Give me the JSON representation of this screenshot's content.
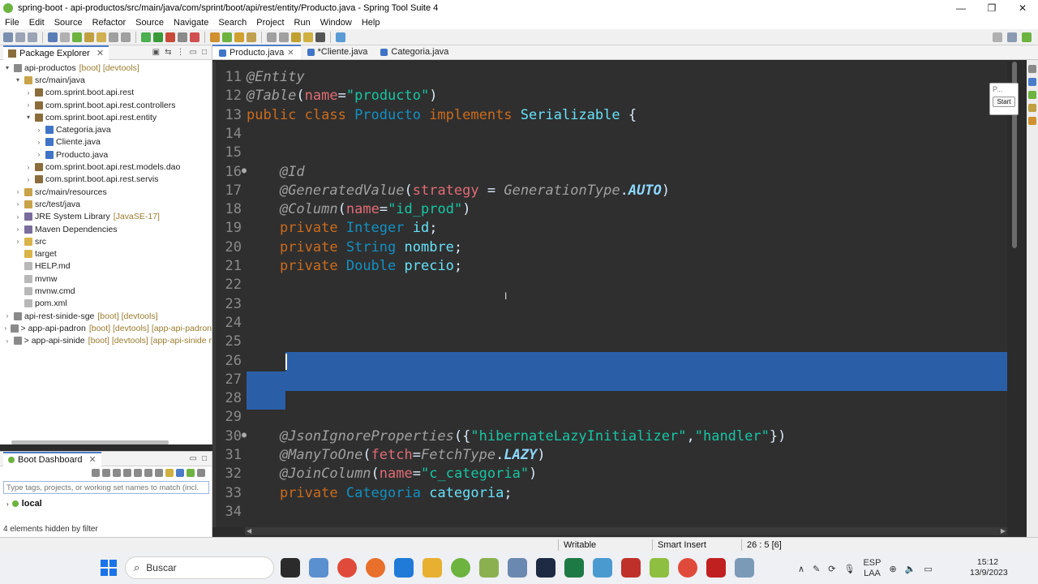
{
  "window": {
    "title": "spring-boot - api-productos/src/main/java/com/sprint/boot/api/rest/entity/Producto.java - Spring Tool Suite 4",
    "minimize": "—",
    "maximize": "❐",
    "close": "✕"
  },
  "menu": [
    "File",
    "Edit",
    "Source",
    "Refactor",
    "Source",
    "Navigate",
    "Search",
    "Project",
    "Run",
    "Window",
    "Help"
  ],
  "package_explorer": {
    "tab_label": "Package Explorer",
    "close": "✕",
    "tree": [
      {
        "indent": 0,
        "arrow": "▾",
        "icon": "project-icon",
        "label": "api-productos",
        "deco": "[boot] [devtools]"
      },
      {
        "indent": 1,
        "arrow": "▾",
        "icon": "source-folder-icon",
        "label": "src/main/java",
        "deco": ""
      },
      {
        "indent": 2,
        "arrow": "›",
        "icon": "package-icon",
        "label": "com.sprint.boot.api.rest",
        "deco": ""
      },
      {
        "indent": 2,
        "arrow": "›",
        "icon": "package-icon",
        "label": "com.sprint.boot.api.rest.controllers",
        "deco": ""
      },
      {
        "indent": 2,
        "arrow": "▾",
        "icon": "package-icon",
        "label": "com.sprint.boot.api.rest.entity",
        "deco": ""
      },
      {
        "indent": 3,
        "arrow": "›",
        "icon": "java-file-icon",
        "label": "Categoria.java",
        "deco": ""
      },
      {
        "indent": 3,
        "arrow": "›",
        "icon": "java-file-icon",
        "label": "Cliente.java",
        "deco": ""
      },
      {
        "indent": 3,
        "arrow": "›",
        "icon": "java-file-icon",
        "label": "Producto.java",
        "deco": ""
      },
      {
        "indent": 2,
        "arrow": "›",
        "icon": "package-icon",
        "label": "com.sprint.boot.api.rest.models.dao",
        "deco": ""
      },
      {
        "indent": 2,
        "arrow": "›",
        "icon": "package-icon",
        "label": "com.sprint.boot.api.rest.servis",
        "deco": ""
      },
      {
        "indent": 1,
        "arrow": "›",
        "icon": "source-folder-icon",
        "label": "src/main/resources",
        "deco": ""
      },
      {
        "indent": 1,
        "arrow": "›",
        "icon": "source-folder-icon",
        "label": "src/test/java",
        "deco": ""
      },
      {
        "indent": 1,
        "arrow": "›",
        "icon": "library-icon",
        "label": "JRE System Library",
        "deco": "[JavaSE-17]"
      },
      {
        "indent": 1,
        "arrow": "›",
        "icon": "library-icon",
        "label": "Maven Dependencies",
        "deco": ""
      },
      {
        "indent": 1,
        "arrow": "›",
        "icon": "folder-icon",
        "label": "src",
        "deco": ""
      },
      {
        "indent": 1,
        "arrow": "",
        "icon": "folder-icon",
        "label": "target",
        "deco": ""
      },
      {
        "indent": 1,
        "arrow": "",
        "icon": "file-icon",
        "label": "HELP.md",
        "deco": ""
      },
      {
        "indent": 1,
        "arrow": "",
        "icon": "file-icon",
        "label": "mvnw",
        "deco": ""
      },
      {
        "indent": 1,
        "arrow": "",
        "icon": "file-icon",
        "label": "mvnw.cmd",
        "deco": ""
      },
      {
        "indent": 1,
        "arrow": "",
        "icon": "file-icon",
        "label": "pom.xml",
        "deco": ""
      },
      {
        "indent": 0,
        "arrow": "›",
        "icon": "project-icon",
        "label": "api-rest-sinide-sge",
        "deco": "[boot] [devtools]"
      },
      {
        "indent": 0,
        "arrow": "›",
        "icon": "project-icon",
        "label": "> app-api-padron",
        "deco": "[boot] [devtools] [app-api-padron"
      },
      {
        "indent": 0,
        "arrow": "›",
        "icon": "project-icon",
        "label": "> app-api-sinide",
        "deco": "[boot] [devtools] [app-api-sinide r"
      }
    ]
  },
  "boot_dashboard": {
    "tab_label": "Boot Dashboard",
    "close": "✕",
    "filter_placeholder": "Type tags, projects, or working set names to match (incl.",
    "local_label": "local",
    "hidden_note": "4 elements hidden by filter"
  },
  "editor": {
    "tabs": [
      {
        "label": "Producto.java",
        "active": true,
        "close": "✕"
      },
      {
        "label": "*Cliente.java",
        "active": false,
        "close": ""
      },
      {
        "label": "Categoria.java",
        "active": false,
        "close": ""
      }
    ],
    "lines": [
      {
        "n": "11",
        "fold": "",
        "tokens": [
          [
            "anno",
            "@Entity"
          ]
        ]
      },
      {
        "n": "12",
        "fold": "",
        "tokens": [
          [
            "anno",
            "@Table"
          ],
          [
            "plain",
            "("
          ],
          [
            "attr",
            "name"
          ],
          [
            "plain",
            "="
          ],
          [
            "str",
            "\"producto\""
          ],
          [
            "plain",
            ")"
          ]
        ]
      },
      {
        "n": "13",
        "fold": "",
        "tokens": [
          [
            "kw",
            "public class "
          ],
          [
            "type",
            "Producto "
          ],
          [
            "kw",
            "implements "
          ],
          [
            "field",
            "Serializable "
          ],
          [
            "plain",
            "{"
          ]
        ]
      },
      {
        "n": "14",
        "fold": "",
        "tokens": []
      },
      {
        "n": "15",
        "fold": "",
        "tokens": []
      },
      {
        "n": "16",
        "fold": "●",
        "tokens": [
          [
            "plain",
            "    "
          ],
          [
            "anno",
            "@Id"
          ]
        ]
      },
      {
        "n": "17",
        "fold": "",
        "tokens": [
          [
            "plain",
            "    "
          ],
          [
            "anno",
            "@GeneratedValue"
          ],
          [
            "plain",
            "("
          ],
          [
            "attr",
            "strategy"
          ],
          [
            "plain",
            " = "
          ],
          [
            "static",
            "GenerationType"
          ],
          [
            "plain",
            "."
          ],
          [
            "enum",
            "AUTO"
          ],
          [
            "plain",
            ")"
          ]
        ]
      },
      {
        "n": "18",
        "fold": "",
        "tokens": [
          [
            "plain",
            "    "
          ],
          [
            "anno",
            "@Column"
          ],
          [
            "plain",
            "("
          ],
          [
            "attr",
            "name"
          ],
          [
            "plain",
            "="
          ],
          [
            "str",
            "\"id_prod\""
          ],
          [
            "plain",
            ")"
          ]
        ]
      },
      {
        "n": "19",
        "fold": "",
        "tokens": [
          [
            "plain",
            "    "
          ],
          [
            "kw",
            "private "
          ],
          [
            "type",
            "Integer "
          ],
          [
            "field",
            "id"
          ],
          [
            "plain",
            ";"
          ]
        ]
      },
      {
        "n": "20",
        "fold": "",
        "tokens": [
          [
            "plain",
            "    "
          ],
          [
            "kw",
            "private "
          ],
          [
            "type",
            "String "
          ],
          [
            "field",
            "nombre"
          ],
          [
            "plain",
            ";"
          ]
        ]
      },
      {
        "n": "21",
        "fold": "",
        "tokens": [
          [
            "plain",
            "    "
          ],
          [
            "kw",
            "private "
          ],
          [
            "type",
            "Double "
          ],
          [
            "field",
            "precio"
          ],
          [
            "plain",
            ";"
          ]
        ]
      },
      {
        "n": "22",
        "fold": "",
        "tokens": []
      },
      {
        "n": "23",
        "fold": "",
        "tokens": []
      },
      {
        "n": "24",
        "fold": "",
        "tokens": []
      },
      {
        "n": "25",
        "fold": "",
        "tokens": []
      },
      {
        "n": "26",
        "fold": "",
        "tokens": []
      },
      {
        "n": "27",
        "fold": "",
        "tokens": []
      },
      {
        "n": "28",
        "fold": "",
        "tokens": []
      },
      {
        "n": "29",
        "fold": "",
        "tokens": []
      },
      {
        "n": "30",
        "fold": "●",
        "tokens": [
          [
            "plain",
            "    "
          ],
          [
            "anno",
            "@JsonIgnoreProperties"
          ],
          [
            "plain",
            "({"
          ],
          [
            "str",
            "\"hibernateLazyInitializer\""
          ],
          [
            "plain",
            ","
          ],
          [
            "str",
            "\"handler\""
          ],
          [
            "plain",
            "})"
          ]
        ]
      },
      {
        "n": "31",
        "fold": "",
        "tokens": [
          [
            "plain",
            "    "
          ],
          [
            "anno",
            "@ManyToOne"
          ],
          [
            "plain",
            "("
          ],
          [
            "attr",
            "fetch"
          ],
          [
            "plain",
            "="
          ],
          [
            "static",
            "FetchType"
          ],
          [
            "plain",
            "."
          ],
          [
            "enum",
            "LAZY"
          ],
          [
            "plain",
            ")"
          ]
        ]
      },
      {
        "n": "32",
        "fold": "",
        "tokens": [
          [
            "plain",
            "    "
          ],
          [
            "anno",
            "@JoinColumn"
          ],
          [
            "plain",
            "("
          ],
          [
            "attr",
            "name"
          ],
          [
            "plain",
            "="
          ],
          [
            "str",
            "\"c_categoria\""
          ],
          [
            "plain",
            ")"
          ]
        ]
      },
      {
        "n": "33",
        "fold": "",
        "tokens": [
          [
            "plain",
            "    "
          ],
          [
            "kw",
            "private "
          ],
          [
            "type",
            "Categoria "
          ],
          [
            "field",
            "categoria"
          ],
          [
            "plain",
            ";"
          ]
        ]
      },
      {
        "n": "34",
        "fold": "",
        "tokens": []
      }
    ],
    "start_widget": {
      "preview": "P...",
      "button": "Start"
    }
  },
  "status": {
    "writable": "Writable",
    "insert_mode": "Smart Insert",
    "position": "26 : 5 [6]"
  },
  "taskbar": {
    "search_label": "Buscar",
    "lang_top": "ESP",
    "lang_bottom": "LAA",
    "time": "15:12",
    "date": "13/9/2023",
    "tray_chevron": "∧"
  },
  "colors": {
    "editor_bg": "#2f2f2f",
    "selection": "#2a5fa8",
    "annotation": "#a0a0a0",
    "keyword": "#cc6c1d",
    "type": "#1290c3",
    "string": "#17c6a3",
    "field": "#66e1f8"
  }
}
